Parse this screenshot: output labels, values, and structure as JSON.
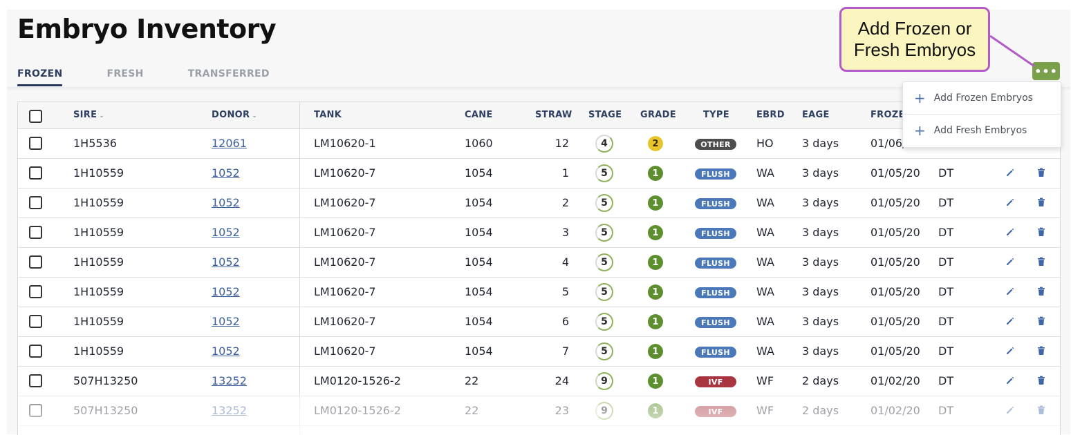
{
  "page": {
    "title": "Embryo Inventory"
  },
  "tabs": [
    {
      "label": "FROZEN",
      "active": true
    },
    {
      "label": "FRESH",
      "active": false
    },
    {
      "label": "TRANSFERRED",
      "active": false
    }
  ],
  "more_button": {
    "label": "•••"
  },
  "menu": {
    "items": [
      {
        "label": "Add Frozen Embryos",
        "icon": "plus-icon"
      },
      {
        "label": "Add Fresh Embryos",
        "icon": "plus-icon"
      }
    ]
  },
  "callout": {
    "line1": "Add Frozen or",
    "line2": "Fresh Embryos"
  },
  "table": {
    "columns": {
      "sire": "SIRE",
      "donor": "DONOR",
      "tank": "TANK",
      "cane": "CANE",
      "straw": "STRAW",
      "stage": "STAGE",
      "grade": "GRADE",
      "type": "TYPE",
      "ebrd": "EBRD",
      "eage": "EAGE",
      "frozen": "FROZEN"
    },
    "rows": [
      {
        "sire": "1H5536",
        "donor": "12061",
        "tank": "LM10620-1",
        "cane": "1060",
        "straw": "12",
        "stage": "4",
        "grade": "2",
        "type": "OTHER",
        "ebrd": "HO",
        "eage": "3 days",
        "frozen": "01/06/",
        "tech": ""
      },
      {
        "sire": "1H10559",
        "donor": "1052",
        "tank": "LM10620-7",
        "cane": "1054",
        "straw": "1",
        "stage": "5",
        "grade": "1",
        "type": "FLUSH",
        "ebrd": "WA",
        "eage": "3 days",
        "frozen": "01/05/20",
        "tech": "DT"
      },
      {
        "sire": "1H10559",
        "donor": "1052",
        "tank": "LM10620-7",
        "cane": "1054",
        "straw": "2",
        "stage": "5",
        "grade": "1",
        "type": "FLUSH",
        "ebrd": "WA",
        "eage": "3 days",
        "frozen": "01/05/20",
        "tech": "DT"
      },
      {
        "sire": "1H10559",
        "donor": "1052",
        "tank": "LM10620-7",
        "cane": "1054",
        "straw": "3",
        "stage": "5",
        "grade": "1",
        "type": "FLUSH",
        "ebrd": "WA",
        "eage": "3 days",
        "frozen": "01/05/20",
        "tech": "DT"
      },
      {
        "sire": "1H10559",
        "donor": "1052",
        "tank": "LM10620-7",
        "cane": "1054",
        "straw": "4",
        "stage": "5",
        "grade": "1",
        "type": "FLUSH",
        "ebrd": "WA",
        "eage": "3 days",
        "frozen": "01/05/20",
        "tech": "DT"
      },
      {
        "sire": "1H10559",
        "donor": "1052",
        "tank": "LM10620-7",
        "cane": "1054",
        "straw": "5",
        "stage": "5",
        "grade": "1",
        "type": "FLUSH",
        "ebrd": "WA",
        "eage": "3 days",
        "frozen": "01/05/20",
        "tech": "DT"
      },
      {
        "sire": "1H10559",
        "donor": "1052",
        "tank": "LM10620-7",
        "cane": "1054",
        "straw": "6",
        "stage": "5",
        "grade": "1",
        "type": "FLUSH",
        "ebrd": "WA",
        "eage": "3 days",
        "frozen": "01/05/20",
        "tech": "DT"
      },
      {
        "sire": "1H10559",
        "donor": "1052",
        "tank": "LM10620-7",
        "cane": "1054",
        "straw": "7",
        "stage": "5",
        "grade": "1",
        "type": "FLUSH",
        "ebrd": "WA",
        "eage": "3 days",
        "frozen": "01/05/20",
        "tech": "DT"
      },
      {
        "sire": "507H13250",
        "donor": "13252",
        "tank": "LM0120-1526-2",
        "cane": "22",
        "straw": "24",
        "stage": "9",
        "grade": "1",
        "type": "IVF",
        "ebrd": "WF",
        "eage": "2 days",
        "frozen": "01/02/20",
        "tech": "DT"
      },
      {
        "sire": "507H13250",
        "donor": "13252",
        "tank": "LM0120-1526-2",
        "cane": "22",
        "straw": "23",
        "stage": "9",
        "grade": "1",
        "type": "IVF",
        "ebrd": "WF",
        "eage": "2 days",
        "frozen": "01/02/20",
        "tech": "DT"
      }
    ]
  },
  "colors": {
    "accent_green": "#7ba04b",
    "grade_1": "#5e8f2e",
    "grade_2": "#e8c52a",
    "type_other": "#4d4d4d",
    "type_flush": "#4a78b8",
    "type_ivf": "#a8353f",
    "callout_border": "#b35ac9",
    "callout_fill": "#fbf6bf"
  }
}
